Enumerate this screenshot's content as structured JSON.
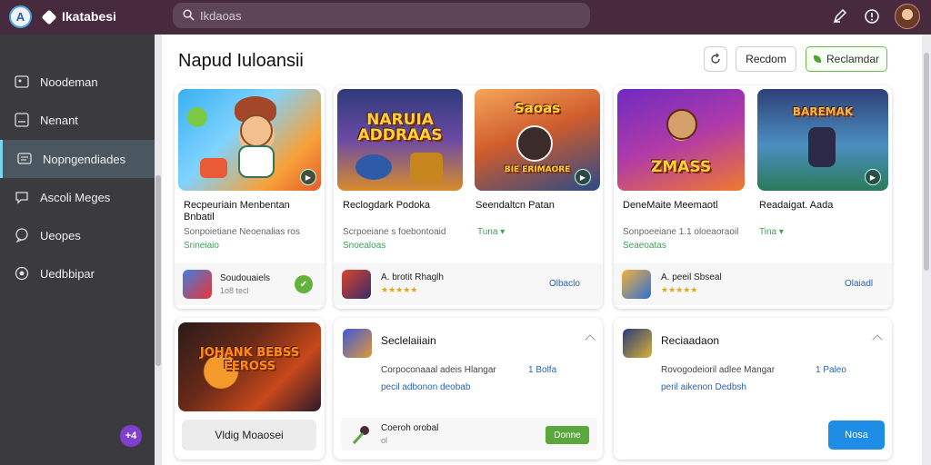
{
  "app": {
    "name": "Ikatabesi"
  },
  "search": {
    "placeholder": "Ikdaoas"
  },
  "sidebar": {
    "items": [
      {
        "label": "Noodeman",
        "icon": "image-icon"
      },
      {
        "label": "Nenant",
        "icon": "square-list-icon"
      },
      {
        "label": "Nopngendiades",
        "icon": "chat-lines-icon",
        "active": true
      },
      {
        "label": "Ascoli Meges",
        "icon": "chat-bubble-icon"
      },
      {
        "label": "Ueopes",
        "icon": "speech-icon"
      },
      {
        "label": "Uedbbipar",
        "icon": "circle-dot-icon"
      }
    ],
    "fab_label": "+4"
  },
  "header": {
    "title": "Napud Iuloansii",
    "btn_secondary": "Recdom",
    "btn_primary": "Reclamdar"
  },
  "cards": [
    {
      "art_title": "",
      "title": "Recpeuriain Menbentan Bnbatil",
      "desc": "Sonpoietiane Neoenalias ros",
      "link": "Srineiaio",
      "foot_name": "Soudouaiels",
      "foot_sub": "1o8 tecl"
    },
    {
      "art_title": "NARUIA ADDRAAS",
      "title": "Reclogdark Podoka",
      "desc": "Scrpoeiane s foebontoaid",
      "link": "Snoealoas",
      "foot_name": "A. brotit Rhaglh",
      "rating": "★★★★★"
    },
    {
      "art_title": "Saoas",
      "art_sub": "BIE ERIMAORE",
      "title": "Seendaltcn Patan",
      "link_inline": "Tuna ▾",
      "link_btn": "Olbaclo"
    },
    {
      "art_title": "ZMASS",
      "title": "DeneMaite Meemaotl",
      "desc": "Sonpoeeiane 1.1 oloeaoraoil",
      "link_inline": "Tina ▾",
      "link": "Seaeoatas",
      "foot_name": "A. peeil Sbseal",
      "rating": "★★★★★"
    },
    {
      "art_title": "BAREMAK",
      "title": "Readaigat. Aada",
      "link_inline": "Tina ▾",
      "link_btn": "Olaiadl"
    }
  ],
  "bottom": {
    "art_title": "JOHANK BEBSS EEROSS",
    "grey_button": "Vldig Moaosei",
    "panel1": {
      "title": "Seclelaiiain",
      "text": "Corpoconaaal adeis Hlangar",
      "text_link": "1 Bolfa",
      "link": "pecil adbonon deobab",
      "foot_name": "Coeroh orobal",
      "foot_sub": "ol",
      "button": "Donne"
    },
    "panel2": {
      "title": "Reciaadaon",
      "text": "Rovogodeioril adlee Mangar",
      "text_link": "1 Paleo",
      "link": "peril aikenon Dedbsh",
      "button": "Nosa"
    }
  },
  "colors": {
    "topbar": "#472a3e",
    "sidebar": "#3b3b3f",
    "accent_green": "#5aa83b",
    "accent_blue": "#1e8de6",
    "accent_purple": "#7f3fcf"
  }
}
